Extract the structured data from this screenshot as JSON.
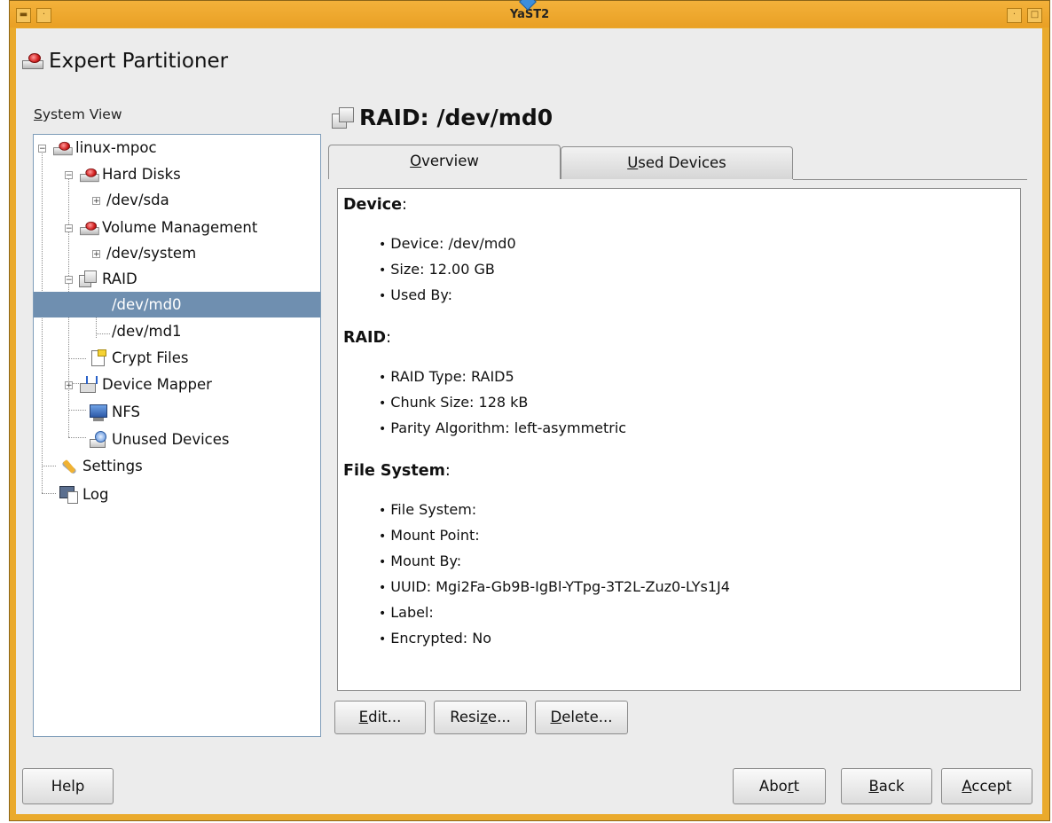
{
  "window": {
    "title": "YaST2"
  },
  "app": {
    "title": "Expert Partitioner"
  },
  "system_view": {
    "label_prefix": "S",
    "label_rest": "ystem View",
    "items": [
      {
        "label": "linux-mpoc"
      },
      {
        "label": "Hard Disks"
      },
      {
        "label": "/dev/sda"
      },
      {
        "label": "Volume Management"
      },
      {
        "label": "/dev/system"
      },
      {
        "label": "RAID"
      },
      {
        "label": "/dev/md0"
      },
      {
        "label": "/dev/md1"
      },
      {
        "label": "Crypt Files"
      },
      {
        "label": "Device Mapper"
      },
      {
        "label": "NFS"
      },
      {
        "label": "Unused Devices"
      },
      {
        "label": "Settings"
      },
      {
        "label": "Log"
      }
    ],
    "selected": "/dev/md0"
  },
  "main": {
    "title": "RAID: /dev/md0",
    "tabs": [
      {
        "mnemonic": "O",
        "rest": "verview"
      },
      {
        "mnemonic": "U",
        "rest": "sed Devices"
      }
    ],
    "sections": [
      {
        "heading": "Device",
        "items": [
          "Device: /dev/md0",
          "Size: 12.00 GB",
          "Used By:"
        ]
      },
      {
        "heading": "RAID",
        "items": [
          "RAID Type: RAID5",
          "Chunk Size: 128 kB",
          "Parity Algorithm: left-asymmetric"
        ]
      },
      {
        "heading": "File System",
        "items": [
          "File System:",
          "Mount Point:",
          "Mount By:",
          "UUID: Mgi2Fa-Gb9B-IgBl-YTpg-3T2L-Zuz0-LYs1J4",
          "Label:",
          "Encrypted: No"
        ]
      }
    ],
    "actions": {
      "edit": {
        "mnemonic": "E",
        "rest": "dit..."
      },
      "resize": {
        "before": "Resi",
        "mnemonic": "z",
        "rest": "e..."
      },
      "delete": {
        "mnemonic": "D",
        "rest": "elete..."
      }
    }
  },
  "footer": {
    "help": "Help",
    "abort": {
      "before": "Abo",
      "mnemonic": "r",
      "rest": "t"
    },
    "back": {
      "mnemonic": "B",
      "rest": "ack"
    },
    "accept": {
      "mnemonic": "A",
      "rest": "ccept"
    }
  }
}
